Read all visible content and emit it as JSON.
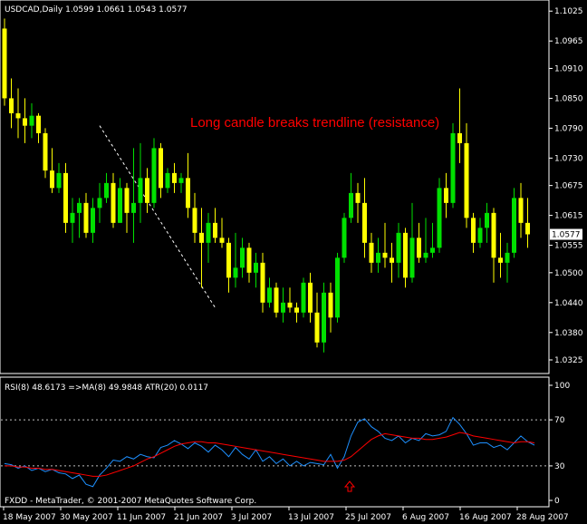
{
  "window": {
    "symbol_line": "USDCAD,Daily  1.0599 1.0661 1.0543 1.0577",
    "footer": "FXDD - MetaTrader, © 2001-2007 MetaQuotes Software Corp.",
    "price_tag": "1.0577"
  },
  "colors": {
    "background": "#000000",
    "bull": "#00e000",
    "bear": "#ffff00",
    "annotation": "#ff0000",
    "rsi_line": "#1e90ff",
    "ma_line": "#ff0000",
    "grid_dash": "#c0c0c0"
  },
  "chart_data": [
    {
      "type": "candlestick",
      "annotation": "Long candle breaks trendline (resistance)",
      "y_ticks": [
        "1.1025",
        "1.0965",
        "1.0910",
        "1.0850",
        "1.0790",
        "1.0730",
        "1.0675",
        "1.0615",
        "1.0555",
        "1.0500",
        "1.0440",
        "1.0380",
        "1.0325"
      ],
      "x_labels": [
        "18 May 2007",
        "30 May 2007",
        "11 Jun 2007",
        "21 Jun 2007",
        "3 Jul 2007",
        "13 Jul 2007",
        "25 Jul 2007",
        "6 Aug 2007",
        "16 Aug 2007",
        "28 Aug 2007"
      ],
      "ylim": [
        1.0305,
        1.104
      ],
      "last_price": 1.0577,
      "trendline": {
        "from": [
          14,
          1.0795
        ],
        "to": [
          31,
          1.043
        ]
      },
      "candles": [
        {
          "o": 1.099,
          "h": 1.101,
          "l": 1.0835,
          "c": 1.085
        },
        {
          "o": 1.085,
          "h": 1.089,
          "l": 1.079,
          "c": 1.082
        },
        {
          "o": 1.082,
          "h": 1.087,
          "l": 1.077,
          "c": 1.081
        },
        {
          "o": 1.081,
          "h": 1.085,
          "l": 1.076,
          "c": 1.0795
        },
        {
          "o": 1.0795,
          "h": 1.084,
          "l": 1.077,
          "c": 1.0815
        },
        {
          "o": 1.0815,
          "h": 1.082,
          "l": 1.076,
          "c": 1.078
        },
        {
          "o": 1.078,
          "h": 1.079,
          "l": 1.069,
          "c": 1.0705
        },
        {
          "o": 1.0705,
          "h": 1.075,
          "l": 1.066,
          "c": 1.067
        },
        {
          "o": 1.067,
          "h": 1.072,
          "l": 1.066,
          "c": 1.07
        },
        {
          "o": 1.07,
          "h": 1.072,
          "l": 1.058,
          "c": 1.06
        },
        {
          "o": 1.06,
          "h": 1.065,
          "l": 1.056,
          "c": 1.062
        },
        {
          "o": 1.062,
          "h": 1.065,
          "l": 1.057,
          "c": 1.064
        },
        {
          "o": 1.064,
          "h": 1.066,
          "l": 1.057,
          "c": 1.058
        },
        {
          "o": 1.058,
          "h": 1.065,
          "l": 1.056,
          "c": 1.063
        },
        {
          "o": 1.063,
          "h": 1.068,
          "l": 1.06,
          "c": 1.065
        },
        {
          "o": 1.065,
          "h": 1.07,
          "l": 1.064,
          "c": 1.068
        },
        {
          "o": 1.068,
          "h": 1.07,
          "l": 1.059,
          "c": 1.06
        },
        {
          "o": 1.06,
          "h": 1.069,
          "l": 1.06,
          "c": 1.067
        },
        {
          "o": 1.067,
          "h": 1.068,
          "l": 1.058,
          "c": 1.062
        },
        {
          "o": 1.062,
          "h": 1.075,
          "l": 1.056,
          "c": 1.064
        },
        {
          "o": 1.064,
          "h": 1.076,
          "l": 1.06,
          "c": 1.069
        },
        {
          "o": 1.069,
          "h": 1.071,
          "l": 1.062,
          "c": 1.064
        },
        {
          "o": 1.064,
          "h": 1.077,
          "l": 1.063,
          "c": 1.075
        },
        {
          "o": 1.075,
          "h": 1.076,
          "l": 1.065,
          "c": 1.067
        },
        {
          "o": 1.067,
          "h": 1.071,
          "l": 1.066,
          "c": 1.07
        },
        {
          "o": 1.07,
          "h": 1.072,
          "l": 1.066,
          "c": 1.068
        },
        {
          "o": 1.068,
          "h": 1.07,
          "l": 1.066,
          "c": 1.069
        },
        {
          "o": 1.069,
          "h": 1.074,
          "l": 1.061,
          "c": 1.063
        },
        {
          "o": 1.063,
          "h": 1.066,
          "l": 1.056,
          "c": 1.058
        },
        {
          "o": 1.058,
          "h": 1.063,
          "l": 1.047,
          "c": 1.056
        },
        {
          "o": 1.056,
          "h": 1.062,
          "l": 1.052,
          "c": 1.06
        },
        {
          "o": 1.06,
          "h": 1.063,
          "l": 1.056,
          "c": 1.057
        },
        {
          "o": 1.057,
          "h": 1.061,
          "l": 1.055,
          "c": 1.056
        },
        {
          "o": 1.056,
          "h": 1.057,
          "l": 1.046,
          "c": 1.049
        },
        {
          "o": 1.049,
          "h": 1.058,
          "l": 1.047,
          "c": 1.051
        },
        {
          "o": 1.051,
          "h": 1.057,
          "l": 1.049,
          "c": 1.055
        },
        {
          "o": 1.055,
          "h": 1.056,
          "l": 1.048,
          "c": 1.05
        },
        {
          "o": 1.05,
          "h": 1.054,
          "l": 1.047,
          "c": 1.052
        },
        {
          "o": 1.052,
          "h": 1.054,
          "l": 1.042,
          "c": 1.044
        },
        {
          "o": 1.044,
          "h": 1.049,
          "l": 1.043,
          "c": 1.047
        },
        {
          "o": 1.047,
          "h": 1.048,
          "l": 1.041,
          "c": 1.042
        },
        {
          "o": 1.042,
          "h": 1.047,
          "l": 1.04,
          "c": 1.044
        },
        {
          "o": 1.044,
          "h": 1.047,
          "l": 1.042,
          "c": 1.043
        },
        {
          "o": 1.043,
          "h": 1.044,
          "l": 1.04,
          "c": 1.042
        },
        {
          "o": 1.042,
          "h": 1.049,
          "l": 1.041,
          "c": 1.048
        },
        {
          "o": 1.048,
          "h": 1.05,
          "l": 1.04,
          "c": 1.042
        },
        {
          "o": 1.042,
          "h": 1.046,
          "l": 1.035,
          "c": 1.036
        },
        {
          "o": 1.036,
          "h": 1.048,
          "l": 1.034,
          "c": 1.046
        },
        {
          "o": 1.046,
          "h": 1.048,
          "l": 1.038,
          "c": 1.041
        },
        {
          "o": 1.041,
          "h": 1.054,
          "l": 1.04,
          "c": 1.053
        },
        {
          "o": 1.053,
          "h": 1.062,
          "l": 1.052,
          "c": 1.061
        },
        {
          "o": 1.061,
          "h": 1.07,
          "l": 1.06,
          "c": 1.066
        },
        {
          "o": 1.066,
          "h": 1.068,
          "l": 1.06,
          "c": 1.064
        },
        {
          "o": 1.064,
          "h": 1.069,
          "l": 1.053,
          "c": 1.056
        },
        {
          "o": 1.056,
          "h": 1.058,
          "l": 1.05,
          "c": 1.052
        },
        {
          "o": 1.052,
          "h": 1.057,
          "l": 1.05,
          "c": 1.054
        },
        {
          "o": 1.054,
          "h": 1.06,
          "l": 1.051,
          "c": 1.053
        },
        {
          "o": 1.053,
          "h": 1.056,
          "l": 1.048,
          "c": 1.052
        },
        {
          "o": 1.052,
          "h": 1.06,
          "l": 1.049,
          "c": 1.058
        },
        {
          "o": 1.058,
          "h": 1.059,
          "l": 1.047,
          "c": 1.049
        },
        {
          "o": 1.049,
          "h": 1.064,
          "l": 1.048,
          "c": 1.057
        },
        {
          "o": 1.057,
          "h": 1.06,
          "l": 1.052,
          "c": 1.053
        },
        {
          "o": 1.053,
          "h": 1.061,
          "l": 1.052,
          "c": 1.054
        },
        {
          "o": 1.054,
          "h": 1.06,
          "l": 1.053,
          "c": 1.055
        },
        {
          "o": 1.055,
          "h": 1.069,
          "l": 1.054,
          "c": 1.067
        },
        {
          "o": 1.067,
          "h": 1.07,
          "l": 1.061,
          "c": 1.064
        },
        {
          "o": 1.064,
          "h": 1.08,
          "l": 1.063,
          "c": 1.078
        },
        {
          "o": 1.078,
          "h": 1.087,
          "l": 1.072,
          "c": 1.076
        },
        {
          "o": 1.076,
          "h": 1.08,
          "l": 1.059,
          "c": 1.061
        },
        {
          "o": 1.061,
          "h": 1.062,
          "l": 1.054,
          "c": 1.056
        },
        {
          "o": 1.056,
          "h": 1.061,
          "l": 1.055,
          "c": 1.059
        },
        {
          "o": 1.059,
          "h": 1.064,
          "l": 1.056,
          "c": 1.062
        },
        {
          "o": 1.062,
          "h": 1.063,
          "l": 1.048,
          "c": 1.053
        },
        {
          "o": 1.053,
          "h": 1.058,
          "l": 1.049,
          "c": 1.052
        },
        {
          "o": 1.052,
          "h": 1.056,
          "l": 1.048,
          "c": 1.054
        },
        {
          "o": 1.054,
          "h": 1.067,
          "l": 1.053,
          "c": 1.065
        },
        {
          "o": 1.065,
          "h": 1.068,
          "l": 1.057,
          "c": 1.06
        },
        {
          "o": 1.06,
          "h": 1.065,
          "l": 1.055,
          "c": 1.0577
        }
      ]
    },
    {
      "type": "line",
      "header": "RSI(8) 48.6173  =>MA(8) 49.9848  ATR(20) 0.0117",
      "y_ticks": [
        "100",
        "70",
        "30",
        "0"
      ],
      "levels": [
        70,
        30
      ],
      "ylim": [
        0,
        100
      ],
      "series": [
        {
          "values": [
            32,
            31,
            28,
            30,
            26,
            28,
            25,
            27,
            24,
            23,
            19,
            22,
            14,
            12,
            22,
            28,
            35,
            34,
            38,
            36,
            40,
            38,
            37,
            46,
            48,
            52,
            49,
            45,
            50,
            47,
            42,
            48,
            44,
            38,
            46,
            40,
            36,
            44,
            34,
            38,
            32,
            36,
            30,
            34,
            30,
            33,
            32,
            31,
            40,
            28,
            38,
            56,
            68,
            71,
            64,
            60,
            54,
            52,
            56,
            50,
            54,
            52,
            58,
            56,
            57,
            60,
            72,
            66,
            58,
            48,
            50,
            50,
            46,
            48,
            44,
            50,
            56,
            51,
            48
          ]
        },
        {
          "values": [
            30,
            30,
            29,
            29,
            28,
            28,
            27,
            27,
            26,
            25,
            24,
            23,
            22,
            21,
            21,
            22,
            24,
            26,
            28,
            30,
            33,
            36,
            38,
            41,
            44,
            47,
            49,
            50,
            51,
            51,
            50,
            50,
            49,
            48,
            47,
            46,
            45,
            44,
            43,
            42,
            41,
            40,
            39,
            38,
            37,
            36,
            35,
            34,
            34,
            34,
            35,
            38,
            43,
            48,
            53,
            56,
            58,
            57,
            56,
            55,
            54,
            54,
            53,
            53,
            54,
            55,
            57,
            59,
            58,
            56,
            55,
            54,
            53,
            52,
            51,
            50,
            51,
            51,
            50
          ]
        }
      ]
    }
  ]
}
